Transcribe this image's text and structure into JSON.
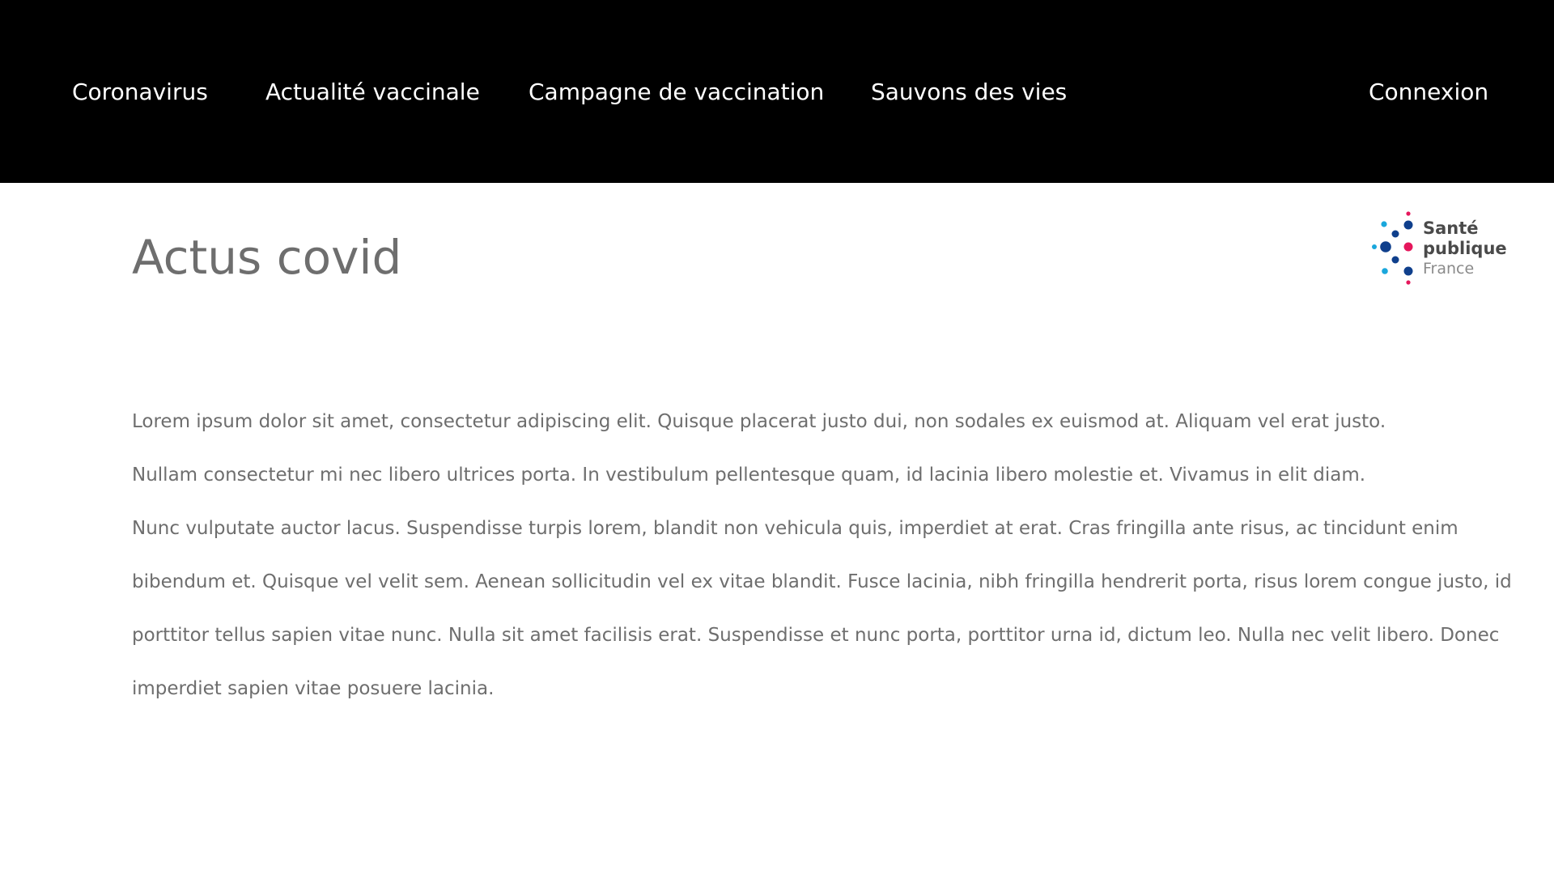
{
  "nav": {
    "items": [
      {
        "label": "Coronavirus"
      },
      {
        "label": "Actualité vaccinale"
      },
      {
        "label": "Campagne de vaccination"
      },
      {
        "label": "Sauvons des vies"
      }
    ],
    "login_label": "Connexion"
  },
  "header": {
    "title": "Actus covid"
  },
  "logo": {
    "icon": "sante-publique-france-logo",
    "line1": "Santé",
    "line2": "publique",
    "line3": "France",
    "colors": {
      "cyan": "#1aa7dc",
      "navy": "#0f3f8c",
      "pink": "#e5175c"
    }
  },
  "content": {
    "paragraphs": [
      "Lorem ipsum dolor sit amet, consectetur adipiscing elit. Quisque placerat justo dui, non sodales ex euismod at. Aliquam vel erat justo.",
      "Nullam consectetur mi nec libero ultrices porta. In vestibulum pellentesque quam, id lacinia libero molestie et. Vivamus in elit diam.",
      "Nunc vulputate auctor lacus. Suspendisse turpis lorem, blandit non vehicula quis, imperdiet at erat. Cras fringilla ante risus, ac tincidunt enim bibendum et. Quisque vel velit sem. Aenean sollicitudin vel ex vitae blandit. Fusce lacinia, nibh fringilla hendrerit porta, risus lorem congue justo, id porttitor tellus sapien vitae nunc. Nulla sit amet facilisis erat. Suspendisse et nunc porta, porttitor urna id, dictum leo. Nulla nec velit libero. Donec imperdiet sapien vitae posuere lacinia."
    ]
  },
  "colors": {
    "nav_background": "#000000",
    "nav_text": "#ffffff",
    "body_text": "#6e6e6e"
  }
}
